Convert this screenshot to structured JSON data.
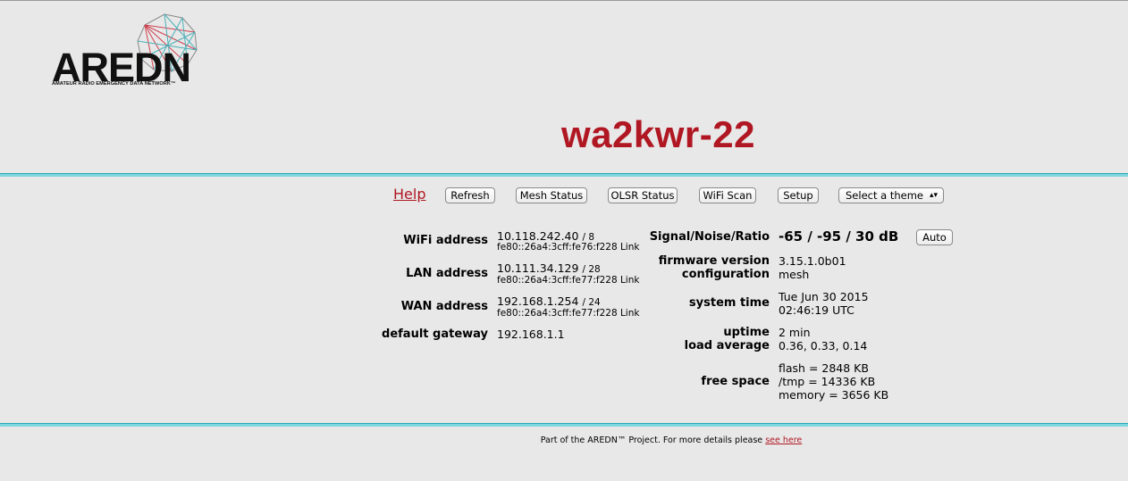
{
  "logo": {
    "wordmark": "AREDN",
    "tagline": "AMATEUR RADIO EMERGENCY DATA NETWORK™"
  },
  "node_name": "wa2kwr-22",
  "nav": {
    "help": "Help",
    "buttons": [
      "Refresh",
      "Mesh Status",
      "OLSR Status",
      "WiFi Scan",
      "Setup"
    ],
    "theme_select": "Select a theme"
  },
  "left": {
    "wifi": {
      "label": "WiFi address",
      "ip": "10.118.242.40",
      "mask": "/ 8",
      "ipv6": "fe80::26a4:3cff:fe76:f228 Link"
    },
    "lan": {
      "label": "LAN address",
      "ip": "10.111.34.129",
      "mask": "/ 28",
      "ipv6": "fe80::26a4:3cff:fe77:f228 Link"
    },
    "wan": {
      "label": "WAN address",
      "ip": "192.168.1.254",
      "mask": "/ 24",
      "ipv6": "fe80::26a4:3cff:fe77:f228 Link"
    },
    "gateway": {
      "label": "default gateway",
      "value": "192.168.1.1"
    }
  },
  "right": {
    "snr": {
      "label": "Signal/Noise/Ratio",
      "value": "-65 / -95 / 30 dB",
      "button": "Auto"
    },
    "firmware": {
      "label": "firmware version",
      "value": "3.15.1.0b01"
    },
    "configuration": {
      "label": "configuration",
      "value": "mesh"
    },
    "system_time": {
      "label": "system time",
      "line1": "Tue Jun 30 2015",
      "line2": "02:46:19 UTC"
    },
    "uptime": {
      "label": "uptime",
      "value": "2 min"
    },
    "load": {
      "label": "load average",
      "value": "0.36, 0.33, 0.14"
    },
    "free_space": {
      "label": "free space",
      "flash": "flash = 2848 KB",
      "tmp": "/tmp = 14336 KB",
      "memory": "memory = 3656 KB"
    }
  },
  "footer": {
    "text": "Part of the AREDN™ Project. For more details please ",
    "link": "see here"
  }
}
